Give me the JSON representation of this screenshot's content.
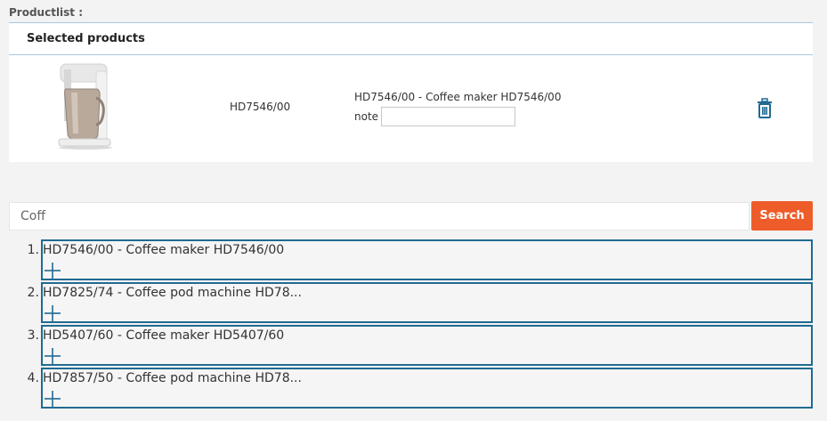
{
  "productlist": {
    "label": "Productlist :"
  },
  "selected": {
    "header": "Selected products",
    "items": [
      {
        "image_icon": "coffee-maker-image",
        "code": "HD7546/00",
        "description": "HD7546/00 - Coffee maker HD7546/00",
        "note_label": "note",
        "note_value": "",
        "delete_icon": "trash-icon"
      }
    ]
  },
  "search": {
    "value": "Coff",
    "button_label": "Search"
  },
  "results": [
    {
      "num": "1.",
      "title": "HD7546/00 - Coffee maker HD7546/00",
      "add_icon": "plus-icon"
    },
    {
      "num": "2.",
      "title": "HD7825/74 - Coffee pod machine HD78...",
      "add_icon": "plus-icon"
    },
    {
      "num": "3.",
      "title": "HD5407/60 - Coffee maker HD5407/60",
      "add_icon": "plus-icon"
    },
    {
      "num": "4.",
      "title": "HD7857/50 - Coffee pod machine HD78...",
      "add_icon": "plus-icon"
    }
  ],
  "colors": {
    "accent_blue": "#206a92",
    "search_button": "#ee5c2a",
    "divider": "#a9c6db"
  }
}
